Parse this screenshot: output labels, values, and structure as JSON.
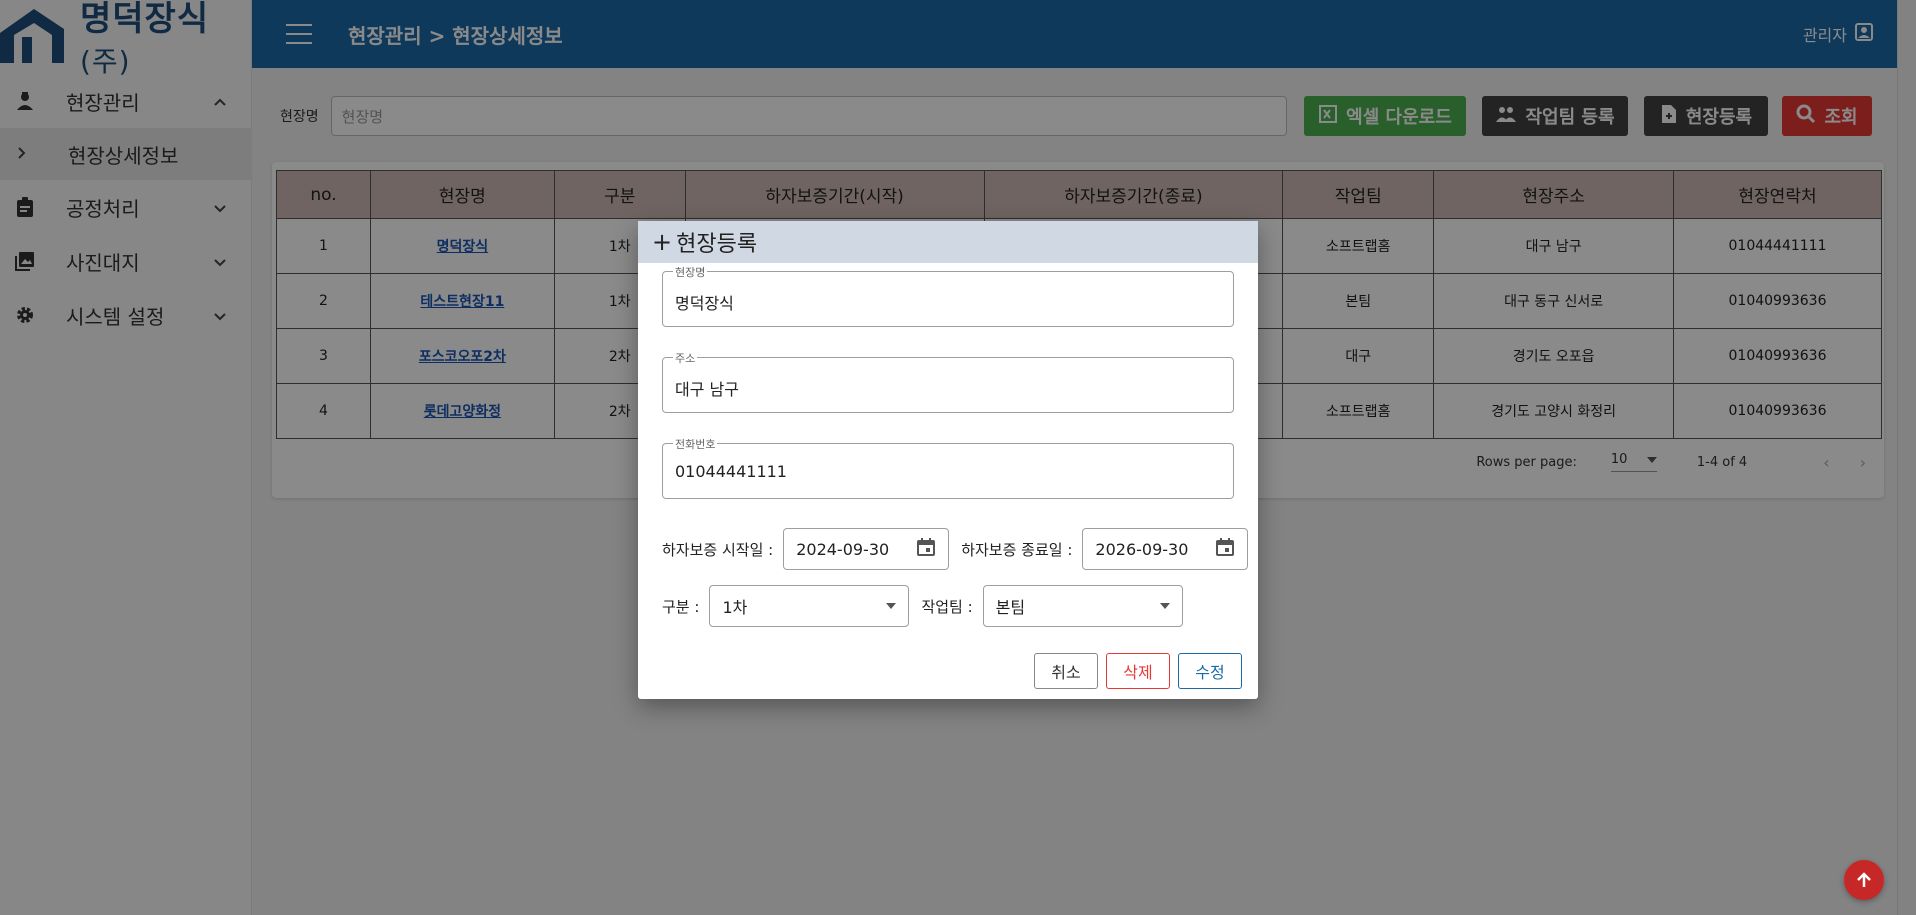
{
  "app": {
    "logo_text": "명덕장식",
    "logo_sub": "(주)"
  },
  "sidebar": {
    "items": [
      {
        "label": "현장관리",
        "icon": "worker-icon",
        "expanded": true
      },
      {
        "label": "공정처리",
        "icon": "clipboard-icon"
      },
      {
        "label": "사진대지",
        "icon": "photo-library-icon"
      },
      {
        "label": "시스템 설정",
        "icon": "gear-icon"
      }
    ],
    "sub_item": "현장상세정보"
  },
  "header": {
    "breadcrumb": "현장관리 > 현장상세정보",
    "user": "관리자"
  },
  "filter": {
    "label": "현장명",
    "placeholder": "현장명"
  },
  "buttons": {
    "excel": "엑셀 다운로드",
    "team": "작업팀 등록",
    "site": "현장등록",
    "search": "조회"
  },
  "table": {
    "columns": [
      "no.",
      "현장명",
      "구분",
      "하자보증기간(시작)",
      "하자보증기간(종료)",
      "작업팀",
      "현장주소",
      "현장연락처"
    ],
    "rows": [
      {
        "no": "1",
        "name": "명덕장식",
        "type": "1차",
        "start": "",
        "end": "",
        "team": "소프트랩홈",
        "addr": "대구 남구",
        "phone": "01044441111"
      },
      {
        "no": "2",
        "name": "테스트현장11",
        "type": "1차",
        "start": "",
        "end": "",
        "team": "본팀",
        "addr": "대구 동구 신서로",
        "phone": "01040993636"
      },
      {
        "no": "3",
        "name": "포스코오포2차",
        "type": "2차",
        "start": "",
        "end": "",
        "team": "대구",
        "addr": "경기도 오포읍",
        "phone": "01040993636"
      },
      {
        "no": "4",
        "name": "롯데고양화정",
        "type": "2차",
        "start": "",
        "end": "",
        "team": "소프트랩홈",
        "addr": "경기도 고양시 화정리",
        "phone": "01040993636"
      }
    ]
  },
  "pager": {
    "rows_label": "Rows per page:",
    "rows_value": "10",
    "range": "1-4 of 4"
  },
  "dialog": {
    "title": "현장등록",
    "name_label": "현장명",
    "name_value": "명덕장식",
    "addr_label": "주소",
    "addr_value": "대구 남구",
    "phone_label": "전화번호",
    "phone_value": "01044441111",
    "start_label": "하자보증 시작일 :",
    "start_value": "2024-09-30",
    "end_label": "하자보증 종료일 :",
    "end_value": "2026-09-30",
    "type_label": "구분 :",
    "type_value": "1차",
    "team_label": "작업팀 :",
    "team_value": "본팀",
    "cancel": "취소",
    "delete": "삭제",
    "edit": "수정"
  },
  "colors": {
    "header": "#1a6aa8",
    "excel": "#4caf50",
    "search": "#e53935",
    "dark_button": "#424242"
  }
}
